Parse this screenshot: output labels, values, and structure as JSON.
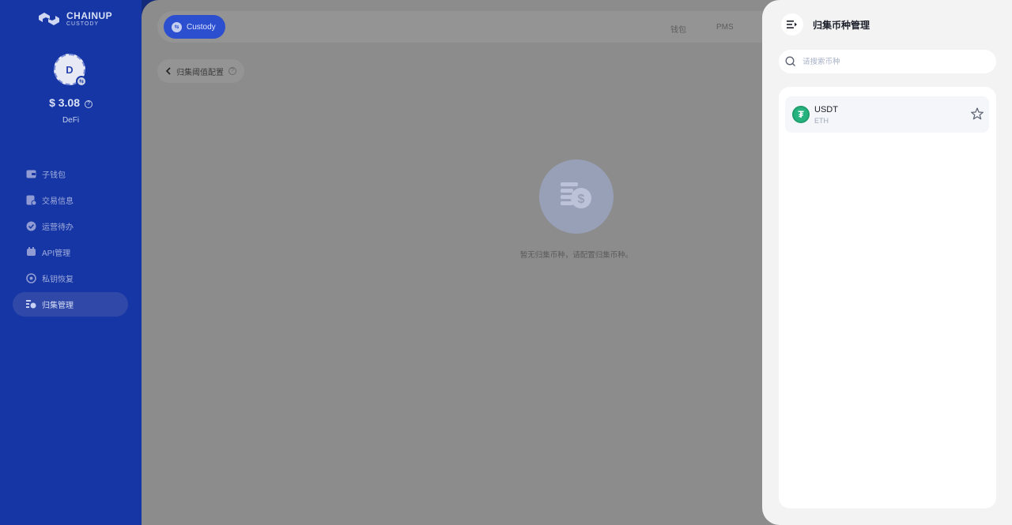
{
  "brand": {
    "name": "CHAINUP",
    "sub": "CUSTODY",
    "logo_icon": "chainup-logo-icon"
  },
  "account": {
    "avatar_letter": "D",
    "balance": "$ 3.08",
    "name": "DeFi"
  },
  "sidebar": {
    "items": [
      {
        "label": "子钱包",
        "icon": "wallet-icon"
      },
      {
        "label": "交易信息",
        "icon": "transaction-icon"
      },
      {
        "label": "运营待办",
        "icon": "check-circle-icon"
      },
      {
        "label": "API管理",
        "icon": "api-icon"
      },
      {
        "label": "私钥恢复",
        "icon": "key-restore-icon"
      },
      {
        "label": "归集管理",
        "icon": "collection-icon",
        "active": true
      }
    ]
  },
  "topbar": {
    "custody_label": "Custody",
    "links": [
      "钱包",
      "PMS"
    ]
  },
  "page": {
    "back_label": "归集阈值配置",
    "empty_text": "暂无归集币种，请配置归集币种。"
  },
  "drawer": {
    "title": "归集币种管理",
    "search_placeholder": "请搜索币种",
    "coins": [
      {
        "symbol": "USDT",
        "chain": "ETH",
        "icon": "tether-icon",
        "color": "#27b37f"
      }
    ]
  },
  "colors": {
    "sidebar_bg": "#1536a4",
    "accent": "#2c4fd0",
    "overlay_bg": "#8c8c8c",
    "drawer_bg": "#f3f3f3"
  }
}
